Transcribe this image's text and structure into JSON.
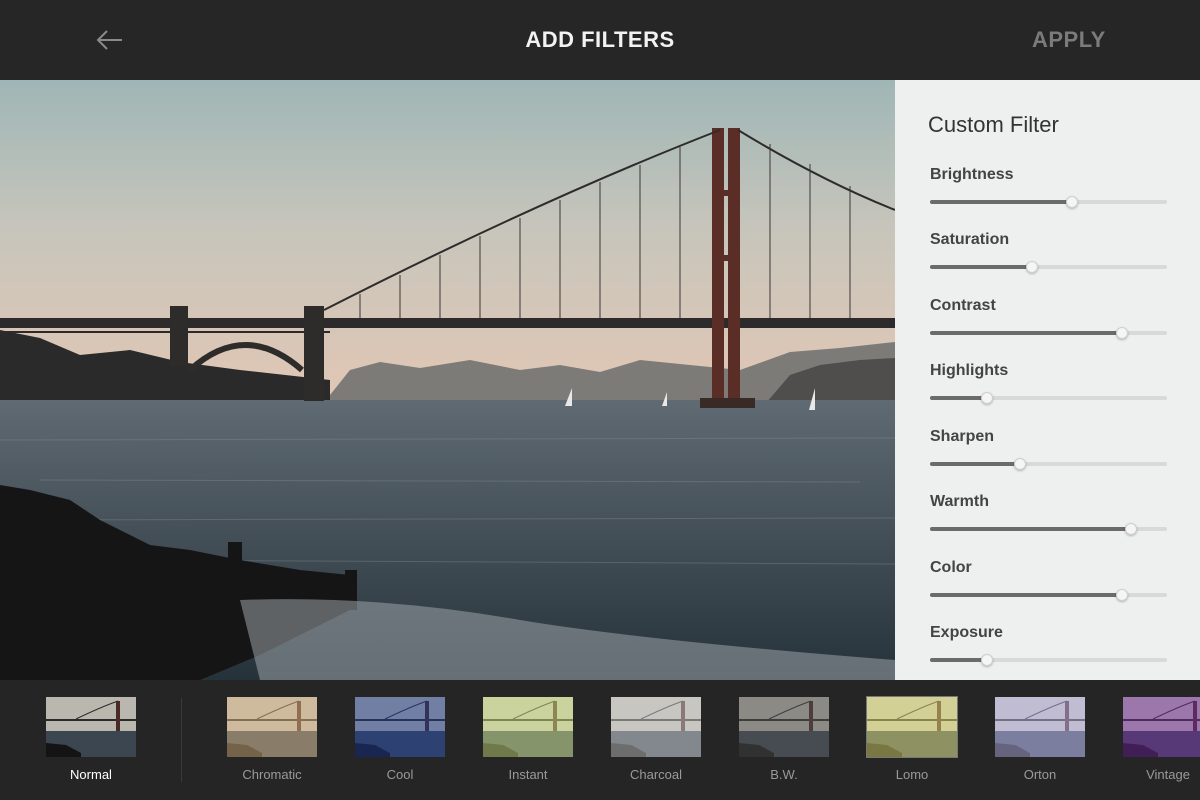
{
  "header": {
    "title": "ADD FILTERS",
    "apply_label": "APPLY",
    "back_icon": "arrow-left-icon"
  },
  "panel": {
    "title": "Custom Filter",
    "sliders": [
      {
        "label": "Brightness",
        "value": 0.6
      },
      {
        "label": "Saturation",
        "value": 0.43
      },
      {
        "label": "Contrast",
        "value": 0.81
      },
      {
        "label": "Highlights",
        "value": 0.24
      },
      {
        "label": "Sharpen",
        "value": 0.38
      },
      {
        "label": "Warmth",
        "value": 0.85
      },
      {
        "label": "Color",
        "value": 0.81
      },
      {
        "label": "Exposure",
        "value": 0.24
      }
    ]
  },
  "filters": [
    {
      "label": "Normal",
      "tint": "none",
      "active": true
    },
    {
      "label": "Chromatic",
      "tint": "#e8c28a"
    },
    {
      "label": "Cool",
      "tint": "#1c3b9c"
    },
    {
      "label": "Instant",
      "tint": "#dff58a"
    },
    {
      "label": "Charcoal",
      "tint": "#d9d9d9"
    },
    {
      "label": "B.W.",
      "tint": "#555555"
    },
    {
      "label": "Lomo",
      "tint": "#f4f07a"
    },
    {
      "label": "Orton",
      "tint": "#c9c4ff"
    },
    {
      "label": "Vintage",
      "tint": "#7a2aa8"
    }
  ],
  "colors": {
    "topbar": "#262626",
    "panel_bg": "#eef0f0",
    "strip_bg": "#252525"
  }
}
